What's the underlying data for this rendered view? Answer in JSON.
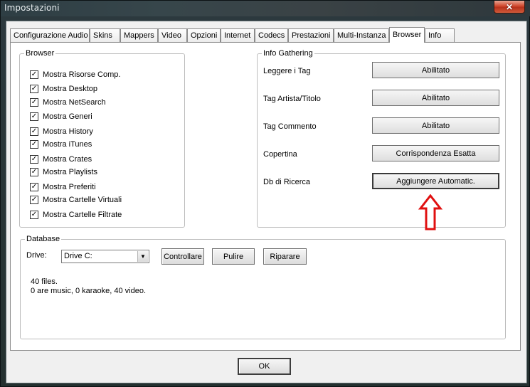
{
  "window": {
    "title": "Impostazioni",
    "close_label": "✕"
  },
  "tabs": [
    {
      "label": "Configurazione Audio"
    },
    {
      "label": "Skins"
    },
    {
      "label": "Mappers"
    },
    {
      "label": "Video"
    },
    {
      "label": "Opzioni"
    },
    {
      "label": "Internet"
    },
    {
      "label": "Codecs"
    },
    {
      "label": "Prestazioni"
    },
    {
      "label": "Multi-Instanza"
    },
    {
      "label": "Browser",
      "active": true
    },
    {
      "label": "Info"
    }
  ],
  "browser_group": {
    "title": "Browser",
    "items": [
      {
        "label": "Mostra Risorse Comp.",
        "checked": true
      },
      {
        "label": "Mostra Desktop",
        "checked": true
      },
      {
        "label": "Mostra NetSearch",
        "checked": true
      },
      {
        "label": "Mostra Generi",
        "checked": true
      },
      {
        "label": "Mostra History",
        "checked": true
      },
      {
        "label": "Mostra iTunes",
        "checked": true
      },
      {
        "label": "Mostra Crates",
        "checked": true
      },
      {
        "label": "Mostra Playlists",
        "checked": true
      },
      {
        "label": "Mostra Preferiti",
        "checked": true
      },
      {
        "label": "Mostra Cartelle Virtuali",
        "checked": true
      },
      {
        "label": "Mostra Cartelle Filtrate",
        "checked": true
      }
    ]
  },
  "info_group": {
    "title": "Info Gathering",
    "rows": [
      {
        "label": "Leggere i Tag",
        "value": "Abilitato"
      },
      {
        "label": "Tag Artista/Titolo",
        "value": "Abilitato"
      },
      {
        "label": "Tag Commento",
        "value": "Abilitato"
      },
      {
        "label": "Copertina",
        "value": "Corrispondenza Esatta"
      },
      {
        "label": "Db di Ricerca",
        "value": "Aggiungere Automatic."
      }
    ]
  },
  "database": {
    "title": "Database",
    "drive_label": "Drive:",
    "drive_value": "Drive C:",
    "check_label": "Controllare",
    "clean_label": "Pulire",
    "repair_label": "Riparare",
    "status_line1": "40 files.",
    "status_line2": "0 are music, 0 karaoke, 40 video."
  },
  "ok_label": "OK",
  "colors": {
    "annotation_arrow": "#e01010"
  }
}
